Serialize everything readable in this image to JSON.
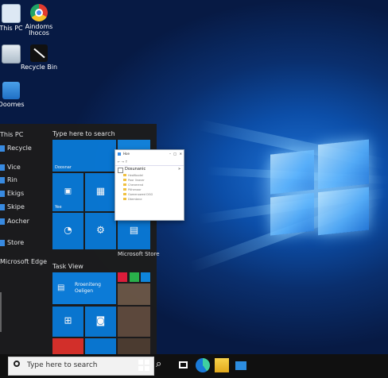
{
  "desktop": {
    "icons": [
      {
        "name": "this-pc-icon",
        "label": "This PC",
        "color": "#dde8f4"
      },
      {
        "name": "chrome-icon",
        "label": "Aindoms\nIhocos",
        "color": "#e23b2e"
      },
      {
        "name": "recycle-bin-icon",
        "label": "",
        "color": "#c9d3dc"
      },
      {
        "name": "app-icon",
        "label": "Recycle Bin",
        "color": "#111111"
      },
      {
        "name": "folder-icon",
        "label": "Ooomes",
        "color": "#2a7fd6"
      }
    ]
  },
  "start_menu": {
    "rail": [
      "This PC",
      "Recycle",
      "Vice",
      "Rin",
      "Ekigs",
      "Skipe",
      "Aocher",
      "Store",
      "Microsoft Edge"
    ],
    "section_top": "Type here to search",
    "section_bottom": "Task View",
    "tiles": {
      "t1_label": "Doosnar",
      "t1b_label": "Go",
      "t2_label": "Yee",
      "store_label": "Microsoft Store",
      "news_label": "Rroeniteng\nOeligen"
    }
  },
  "explorer": {
    "title": "Hoe",
    "nav_label": "Dosunanic",
    "folders": [
      "Heafibodel",
      "Poor linaver",
      "Chenerend",
      "Pithenaor",
      "Gamenowed DGG",
      "Dtemtene"
    ]
  },
  "taskbar": {
    "search_placeholder": "Type here to search"
  },
  "colors": {
    "accent": "#0a78d4",
    "taskbar": "#101010",
    "start_bg": "#1c1c1c"
  }
}
